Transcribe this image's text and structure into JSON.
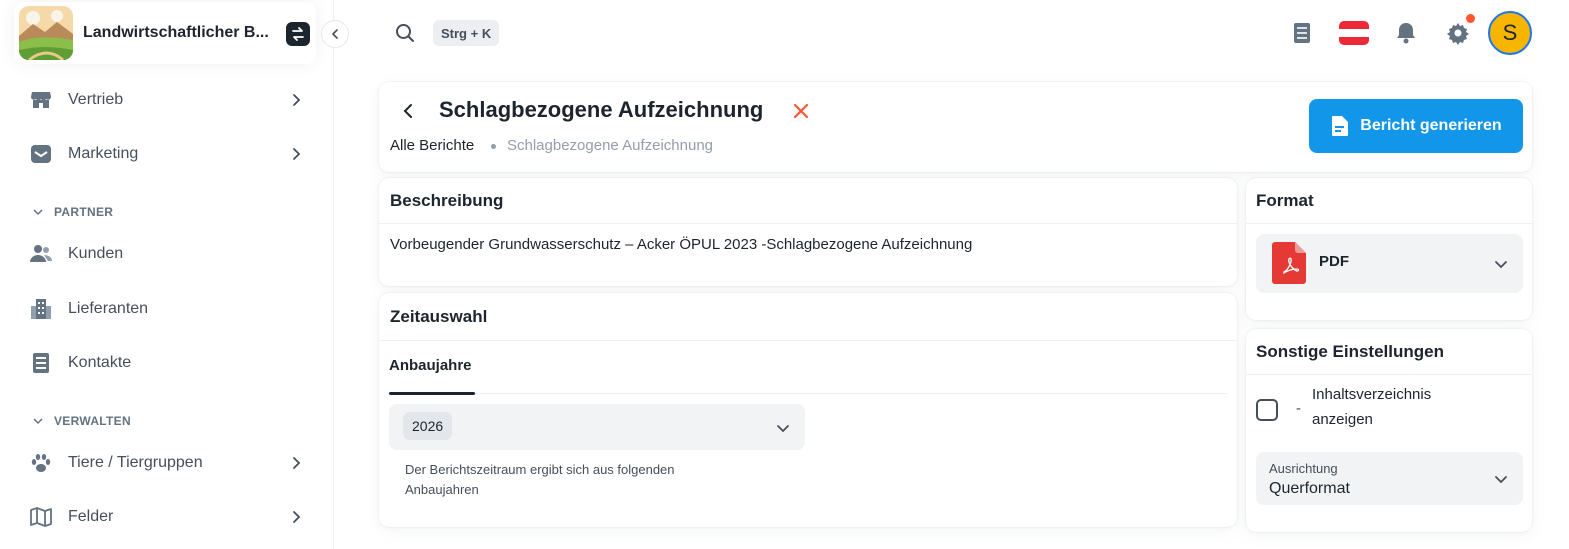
{
  "workspace": {
    "name": "Landwirtschaftlicher B..."
  },
  "sidebar": {
    "top_items": [
      {
        "label": "Vertrieb",
        "icon": "store-icon"
      },
      {
        "label": "Marketing",
        "icon": "mailbox-icon"
      }
    ],
    "sections": [
      {
        "title": "PARTNER",
        "items": [
          {
            "label": "Kunden",
            "icon": "users-icon"
          },
          {
            "label": "Lieferanten",
            "icon": "building-icon"
          },
          {
            "label": "Kontakte",
            "icon": "contact-book-icon"
          }
        ]
      },
      {
        "title": "VERWALTEN",
        "items": [
          {
            "label": "Tiere / Tiergruppen",
            "icon": "paw-icon"
          },
          {
            "label": "Felder",
            "icon": "map-icon"
          }
        ]
      }
    ]
  },
  "topbar": {
    "shortcut": "Strg + K",
    "avatar_initial": "S"
  },
  "page": {
    "title": "Schlagbezogene Aufzeichnung",
    "breadcrumb": [
      "Alle Berichte",
      "Schlagbezogene Aufzeichnung"
    ],
    "generate_button": "Bericht generieren"
  },
  "description": {
    "title": "Beschreibung",
    "text": "Vorbeugender Grundwasserschutz – Acker ÖPUL 2023 -Schlagbezogene Aufzeichnung"
  },
  "time": {
    "title": "Zeitauswahl",
    "tab": "Anbaujahre",
    "selected_year": "2026",
    "helper": "Der Berichtszeitraum ergibt sich aus folgenden Anbaujahren"
  },
  "format": {
    "title": "Format",
    "value": "PDF"
  },
  "settings": {
    "title": "Sonstige Einstellungen",
    "toc_prefix": "-",
    "toc_label": "Inhaltsverzeichnis anzeigen",
    "orientation_label": "Ausrichtung",
    "orientation_value": "Querformat"
  },
  "colors": {
    "primary": "#1296ea",
    "danger": "#ff5630",
    "avatar": "#f7b500",
    "pdf": "#e53935"
  }
}
